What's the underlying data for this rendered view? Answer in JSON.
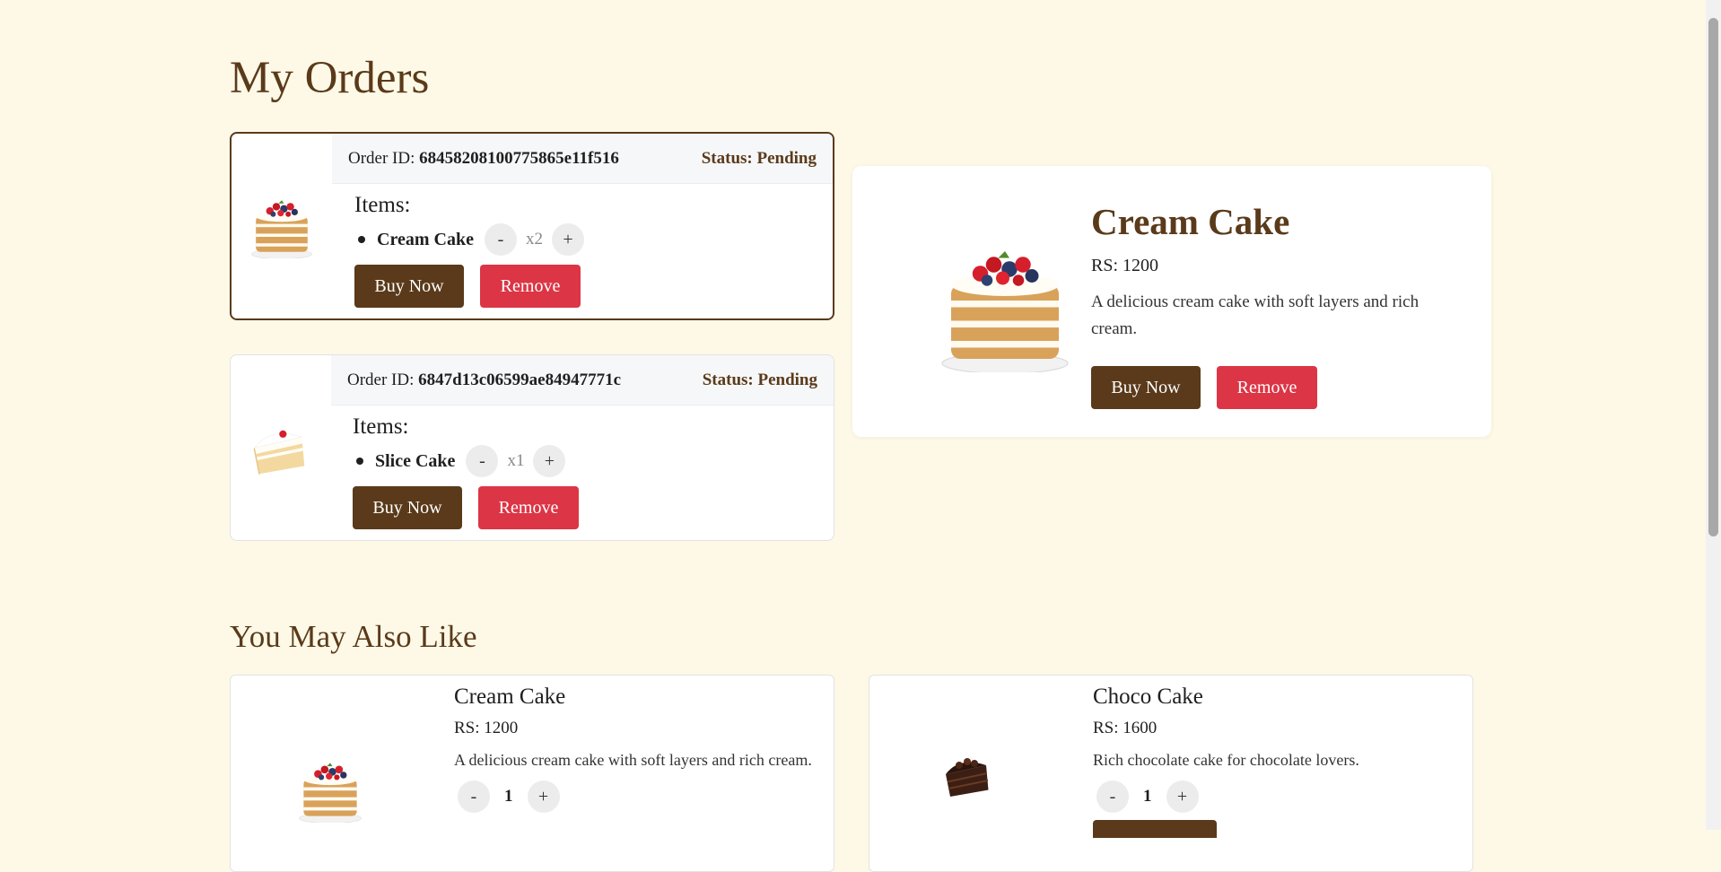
{
  "page": {
    "title": "My Orders",
    "recommend_title": "You May Also Like"
  },
  "orders": [
    {
      "id_label": "Order ID:",
      "id": "68458208100775865e11f516",
      "status": "Status: Pending",
      "items_label": "Items:",
      "item": {
        "name": "Cream Cake",
        "count": "x2",
        "minus": "-",
        "plus": "+"
      },
      "buy_label": "Buy Now",
      "remove_label": "Remove"
    },
    {
      "id_label": "Order ID:",
      "id": "6847d13c06599ae84947771c",
      "status": "Status: Pending",
      "items_label": "Items:",
      "item": {
        "name": "Slice Cake",
        "count": "x1",
        "minus": "-",
        "plus": "+"
      },
      "buy_label": "Buy Now",
      "remove_label": "Remove"
    }
  ],
  "detail": {
    "name": "Cream Cake",
    "price": "RS: 1200",
    "description": "A delicious cream cake with soft layers and rich cream.",
    "buy_label": "Buy Now",
    "remove_label": "Remove"
  },
  "recommendations": [
    {
      "name": "Cream Cake",
      "price": "RS: 1200",
      "description": "A delicious cream cake with soft layers and rich cream.",
      "minus": "-",
      "qty": "1",
      "plus": "+"
    },
    {
      "name": "Choco Cake",
      "price": "RS: 1600",
      "description": "Rich chocolate cake for chocolate lovers.",
      "minus": "-",
      "qty": "1",
      "plus": "+"
    }
  ],
  "colors": {
    "brand_brown": "#5a3a1a",
    "remove_red": "#dc3545",
    "background": "#fef9e7"
  }
}
